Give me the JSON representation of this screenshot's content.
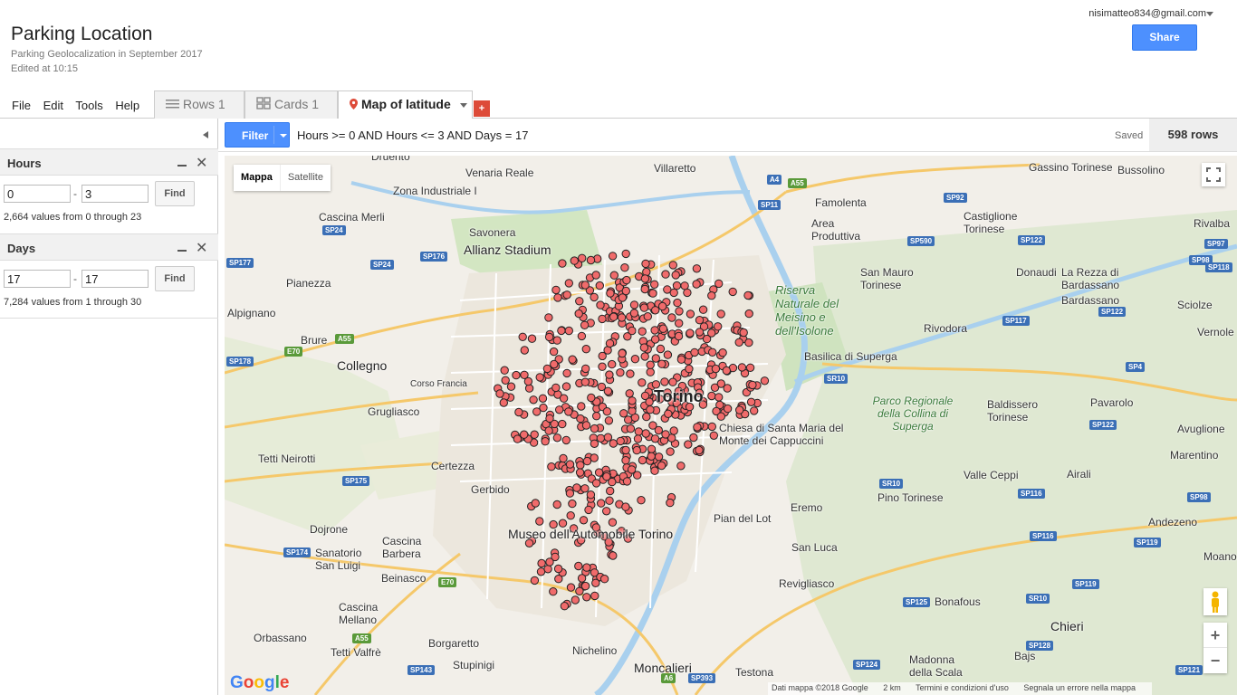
{
  "header": {
    "title": "Parking Location",
    "subtitle": "Parking Geolocalization in September 2017",
    "edited": "Edited at 10:15",
    "account": "nisimatteo834@gmail.com",
    "share_label": "Share"
  },
  "menu": [
    "File",
    "Edit",
    "Tools",
    "Help"
  ],
  "tabs": [
    {
      "label": "Rows 1",
      "icon": "rows-icon"
    },
    {
      "label": "Cards 1",
      "icon": "cards-icon"
    },
    {
      "label": "Map of latitude",
      "icon": "map-pin-icon"
    }
  ],
  "add_tab_label": "+",
  "facets": [
    {
      "title": "Hours",
      "min": "0",
      "max": "3",
      "find_label": "Find",
      "info": "2,664 values from 0 through 23"
    },
    {
      "title": "Days",
      "min": "17",
      "max": "17",
      "find_label": "Find",
      "info": "7,284 values from 1 through 30"
    }
  ],
  "filter": {
    "button_label": "Filter",
    "expression": "Hours >= 0 AND Hours <= 3 AND Days = 17",
    "status": "Saved",
    "rows": "598 rows"
  },
  "map": {
    "type_options": [
      "Mappa",
      "Satellite"
    ],
    "zoom_in": "+",
    "zoom_out": "−",
    "footer": {
      "data": "Dati mappa ©2018 Google",
      "scale": "2 km",
      "terms": "Termini e condizioni d'uso",
      "report": "Segnala un errore nella mappa"
    },
    "logo": "Google",
    "marker_color": "#f06b6b",
    "labels": [
      "Venaria Reale",
      "Villaretto",
      "Gassino Torinese",
      "Bussolino",
      "Druento",
      "Zona Industriale I",
      "Savonera",
      "Famolenta",
      "Area Produttiva",
      "Castiglione Torinese",
      "Rivalba",
      "Allianz Stadium",
      "Cascina Merli",
      "Donaudi",
      "La Rezza di Bardassano",
      "Bardassano",
      "Sciolze",
      "Pianezza",
      "San Mauro Torinese",
      "Riserva Naturale del Meisino e dell'Isolone",
      "Rivodora",
      "Alpignano",
      "Brure",
      "Collegno",
      "Basilica di Superga",
      "Vernole",
      "Corso Francia",
      "Torino",
      "Grugliasco",
      "Parco Regionale della Collina di Superga",
      "Baldissero Torinese",
      "Pavarolo",
      "Chiesa di Santa Maria del Monte dei Cappuccini",
      "Avuglione",
      "Tetti Neirotti",
      "Marentino",
      "Certezza",
      "Valle Ceppi",
      "Airali",
      "Gerbido",
      "Pino Torinese",
      "Eremo",
      "Pian del Lot",
      "Andezeno",
      "Dojrone",
      "Museo dell'Automobile Torino",
      "Cascina Barbera",
      "Sanatorio San Luigi",
      "San Luca",
      "Moano",
      "Beinasco",
      "Revigliasco",
      "Bonafous",
      "Cascina Mellano",
      "Chieri",
      "Orbassano",
      "Borgaretto",
      "Nichelino",
      "Bajs",
      "Tetti Valfrè",
      "Stupinigi",
      "Moncalieri",
      "Testona",
      "Madonna della Scala"
    ]
  }
}
